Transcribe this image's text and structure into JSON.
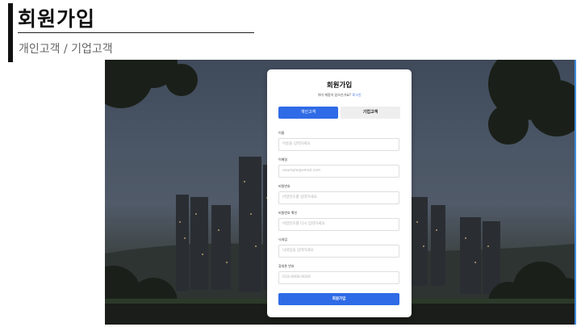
{
  "page": {
    "title": "회원가입",
    "subtitle": "개인고객 / 기업고객"
  },
  "form": {
    "title": "회원가입",
    "login_prompt": "이미 계정이 있으신가요?",
    "login_link": "로그인",
    "tabs": [
      {
        "label": "개인고객",
        "active": true
      },
      {
        "label": "기업고객",
        "active": false
      }
    ],
    "fields": [
      {
        "label": "이름",
        "placeholder": "이름을 입력하세요"
      },
      {
        "label": "이메일",
        "placeholder": "example@email.com"
      },
      {
        "label": "비밀번호",
        "placeholder": "비밀번호를 입력하세요"
      },
      {
        "label": "비밀번호 확인",
        "placeholder": "비밀번호를 다시 입력하세요"
      },
      {
        "label": "닉네임",
        "placeholder": "닉네임을 입력하세요"
      },
      {
        "label": "휴대폰 번호",
        "placeholder": "010-0000-0000"
      }
    ],
    "submit_label": "회원가입"
  },
  "colors": {
    "accent": "#2f6be6",
    "title_bar": "#111111",
    "edge_accent": "#3e8de0"
  }
}
